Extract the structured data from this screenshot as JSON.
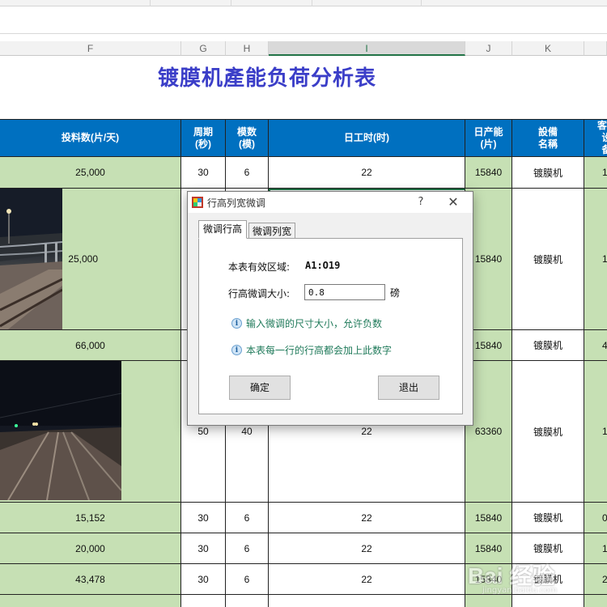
{
  "column_headers": [
    "F",
    "G",
    "H",
    "I",
    "J",
    "K"
  ],
  "title": "镀膜机產能负荷分析表",
  "table": {
    "headers": {
      "f": "投料数(片/天)",
      "g": [
        "周期",
        "(秒)"
      ],
      "h": [
        "模数",
        "(模)"
      ],
      "i": "日工时(时)",
      "j": [
        "日产能",
        "(片)"
      ],
      "k": [
        "設備",
        "名稱"
      ],
      "l": [
        "客",
        "设备"
      ]
    },
    "rows": [
      {
        "f": "25,000",
        "g": "30",
        "h": "6",
        "i": "22",
        "j": "15840",
        "k": "镀膜机",
        "l": "1"
      },
      {
        "f": "25,000",
        "g": "",
        "h": "",
        "i": "",
        "j": "15840",
        "k": "镀膜机",
        "l": "1"
      },
      {
        "f": "66,000",
        "g": "",
        "h": "",
        "i": "",
        "j": "15840",
        "k": "镀膜机",
        "l": "4"
      },
      {
        "f": "",
        "g": "50",
        "h": "40",
        "i": "22",
        "j": "63360",
        "k": "镀膜机",
        "l": "1"
      },
      {
        "f": "15,152",
        "g": "30",
        "h": "6",
        "i": "22",
        "j": "15840",
        "k": "镀膜机",
        "l": "0"
      },
      {
        "f": "20,000",
        "g": "30",
        "h": "6",
        "i": "22",
        "j": "15840",
        "k": "镀膜机",
        "l": "1"
      },
      {
        "f": "43,478",
        "g": "30",
        "h": "6",
        "i": "22",
        "j": "15840",
        "k": "镀膜机",
        "l": "2"
      }
    ]
  },
  "dialog": {
    "title": "行高列宽微调",
    "help": "?",
    "close": "✕",
    "tabs": [
      "微调行高",
      "微调列宽"
    ],
    "range_label": "本表有效区域:",
    "range_value": "A1:O19",
    "adjust_label": "行高微调大小:",
    "adjust_value": "0.8",
    "unit": "磅",
    "info1": "输入微调的尺寸大小，允许负数",
    "info2": "本表每一行的行高都会加上此数字",
    "ok": "确定",
    "exit": "退出"
  },
  "watermark": {
    "text": "Bai 经验",
    "sub": "jingyan.baidu.com"
  },
  "colors": {
    "header_blue": "#0070c0",
    "green": "#c6e0b4",
    "title": "#3b3ec8",
    "selected_col": "#217346"
  },
  "icons": [
    "app-icon",
    "help-icon",
    "close-icon",
    "info-icon"
  ]
}
